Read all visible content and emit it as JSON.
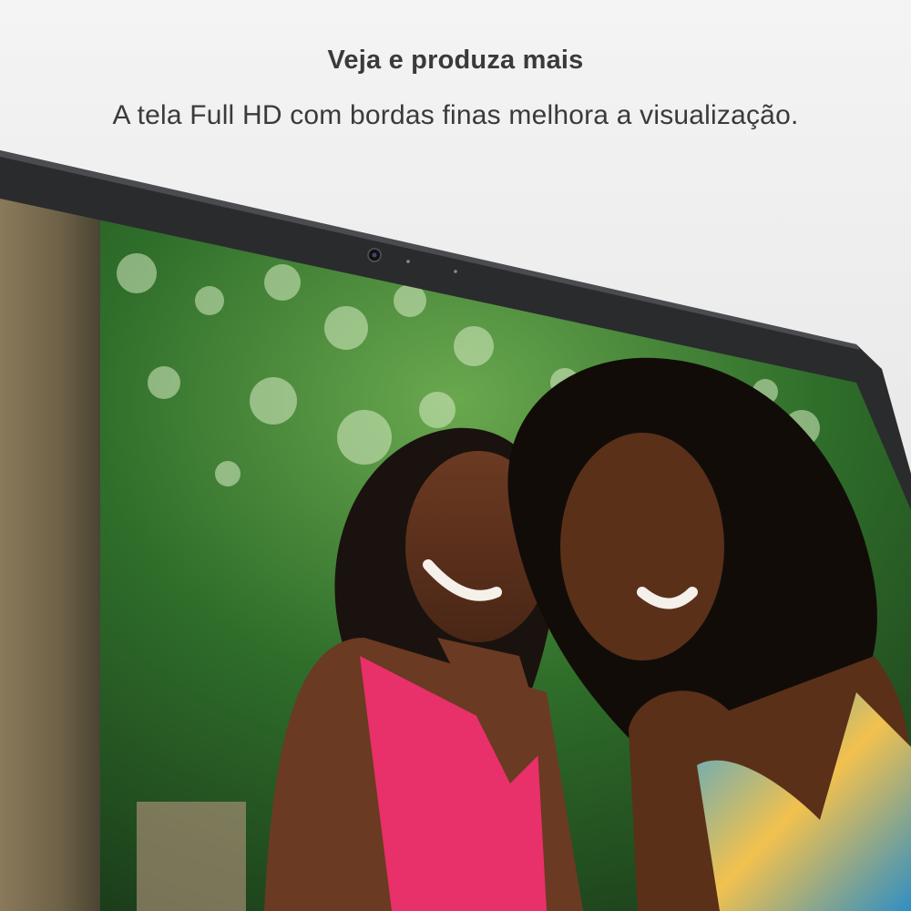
{
  "header": {
    "title": "Veja e produza mais",
    "subtitle": "A tela Full HD com bordas finas melhora a visualização."
  },
  "colors": {
    "background": "#ececec",
    "text": "#3a3a3a",
    "bezel": "#2a2b2d",
    "bezel_edge": "#4a4c50"
  },
  "icons": {
    "camera": "webcam-icon",
    "mic_left": "microphone-icon",
    "mic_right": "microphone-icon"
  },
  "screen": {
    "content": "photo-of-two-smiling-women-outdoors"
  }
}
